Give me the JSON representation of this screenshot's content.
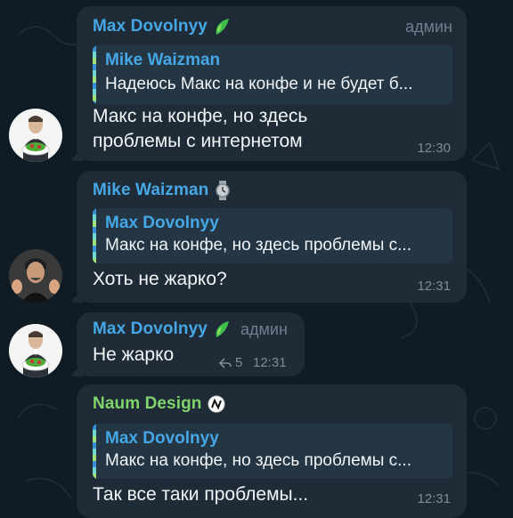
{
  "colors": {
    "background": "#0f1c26",
    "bubble": "#1f2c37",
    "quote_bg": "#243644",
    "blue_name": "#45a7e6",
    "green_name": "#7fd46a",
    "meta": "#7d8b97"
  },
  "messages": [
    {
      "sender": "Max Dovolnyy",
      "sender_icon": "green-leaf-icon",
      "badge": "админ",
      "quote": {
        "name": "Mike Waizman",
        "text": "Надеюсь Макс на конфе и не будет б..."
      },
      "text_lines": [
        "Макс на конфе, но здесь",
        "проблемы с интернетом"
      ],
      "time": "12:30"
    },
    {
      "sender": "Mike Waizman",
      "sender_icon": "watch-icon",
      "quote": {
        "name": "Max Dovolnyy",
        "text": "Макс на конфе, но здесь проблемы с..."
      },
      "text": "Хоть не жарко?",
      "time": "12:31"
    },
    {
      "sender": "Max Dovolnyy",
      "sender_icon": "green-leaf-icon",
      "badge": "админ",
      "text": "Не жарко",
      "reply_count": "5",
      "time": "12:31"
    },
    {
      "sender": "Naum Design",
      "sender_icon": "naum-logo-icon",
      "quote": {
        "name": "Max Dovolnyy",
        "text": "Макс на конфе, но здесь проблемы с..."
      },
      "text": "Так все таки проблемы...",
      "time": "12:31"
    }
  ]
}
